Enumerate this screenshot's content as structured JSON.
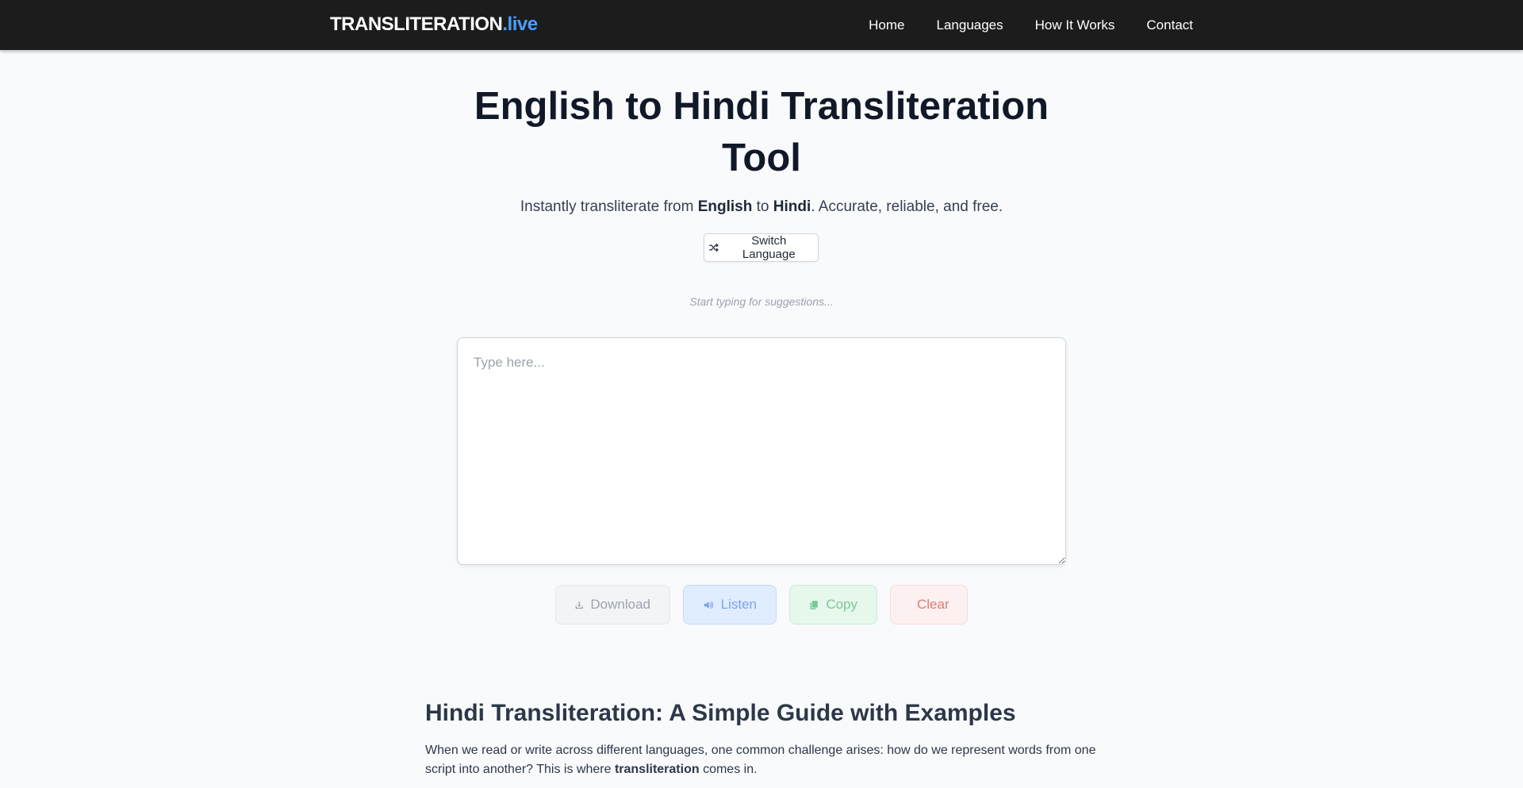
{
  "nav": {
    "brand_main": "TRANSLITERATION",
    "brand_tld": ".live",
    "links": [
      "Home",
      "Languages",
      "How It Works",
      "Contact"
    ]
  },
  "hero": {
    "title": "English to Hindi Transliteration Tool",
    "subtitle_prefix": "Instantly transliterate from ",
    "source_lang": "English",
    "subtitle_mid": " to ",
    "target_lang": "Hindi",
    "subtitle_suffix": ". Accurate, reliable, and free.",
    "switch_label": "Switch Language"
  },
  "editor": {
    "suggestions_hint": "Start typing for suggestions...",
    "placeholder": "Type here...",
    "value": ""
  },
  "actions": {
    "download": "Download",
    "listen": "Listen",
    "copy": "Copy",
    "clear": "Clear"
  },
  "guide": {
    "heading": "Hindi Transliteration: A Simple Guide with Examples",
    "para_before": "When we read or write across different languages, one common challenge arises: how do we represent words from one script into another? This is where ",
    "para_bold": "transliteration",
    "para_after": " comes in."
  },
  "colors": {
    "navbar_bg": "#1c1c1c",
    "brand_accent": "#4a9eff",
    "page_bg": "#f8fafc"
  },
  "icons": {
    "switch": "shuffle-icon",
    "download": "download-icon",
    "listen": "volume-icon",
    "copy": "copy-icon",
    "clear": "trash-icon"
  }
}
